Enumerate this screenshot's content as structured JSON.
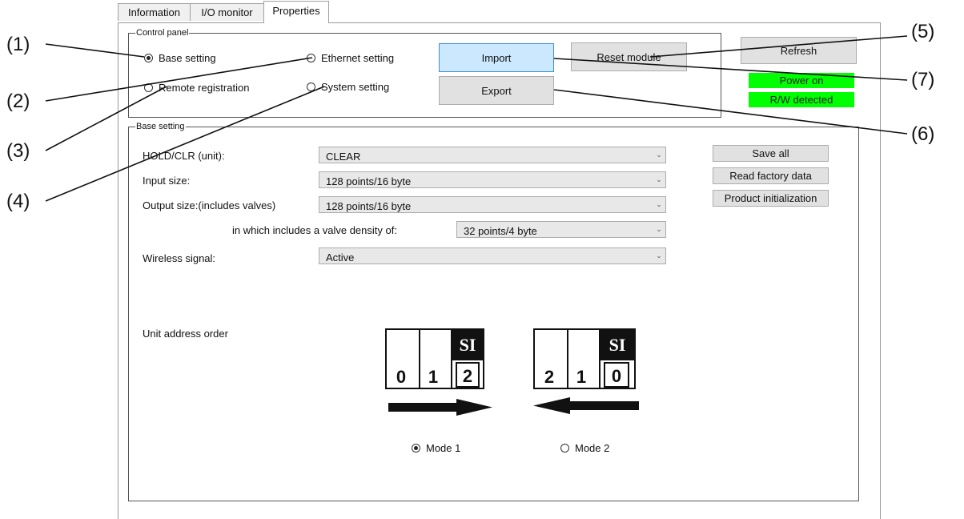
{
  "tabs": [
    {
      "label": "Information"
    },
    {
      "label": "I/O monitor"
    },
    {
      "label": "Properties"
    }
  ],
  "control_panel": {
    "title": "Control panel",
    "radios": {
      "base_setting": "Base setting",
      "ethernet_setting": "Ethernet setting",
      "remote_registration": "Remote registration",
      "system_setting": "System setting"
    },
    "selected": "Base setting",
    "buttons": {
      "import": "Import",
      "export": "Export",
      "reset_module": "Reset module",
      "refresh": "Refresh"
    },
    "status": {
      "power": "Power on",
      "rw": "R/W detected",
      "color": "#00ff00"
    }
  },
  "base_setting": {
    "title": "Base setting",
    "fields": {
      "hold_clr": {
        "label": "HOLD/CLR (unit):",
        "value": "CLEAR"
      },
      "input_size": {
        "label": "Input size:",
        "value": "128 points/16 byte"
      },
      "output_size": {
        "label": "Output size:(includes valves)",
        "value": "128 points/16 byte"
      },
      "valve_density": {
        "label": "in which includes a valve density of:",
        "value": "32 points/4 byte"
      },
      "wireless": {
        "label": "Wireless signal:",
        "value": "Active"
      }
    },
    "buttons": {
      "save_all": "Save all",
      "read_factory": "Read factory data",
      "product_init": "Product initialization"
    },
    "unit_address_order": {
      "label": "Unit address order",
      "mode1": {
        "label": "Mode 1",
        "si": "SI",
        "digits": [
          "0",
          "1",
          "2"
        ],
        "selected": true
      },
      "mode2": {
        "label": "Mode 2",
        "si": "SI",
        "digits": [
          "2",
          "1",
          "0"
        ],
        "selected": false
      }
    }
  },
  "callouts": {
    "c1": "(1)",
    "c2": "(2)",
    "c3": "(3)",
    "c4": "(4)",
    "c5": "(5)",
    "c6": "(6)",
    "c7": "(7)"
  }
}
